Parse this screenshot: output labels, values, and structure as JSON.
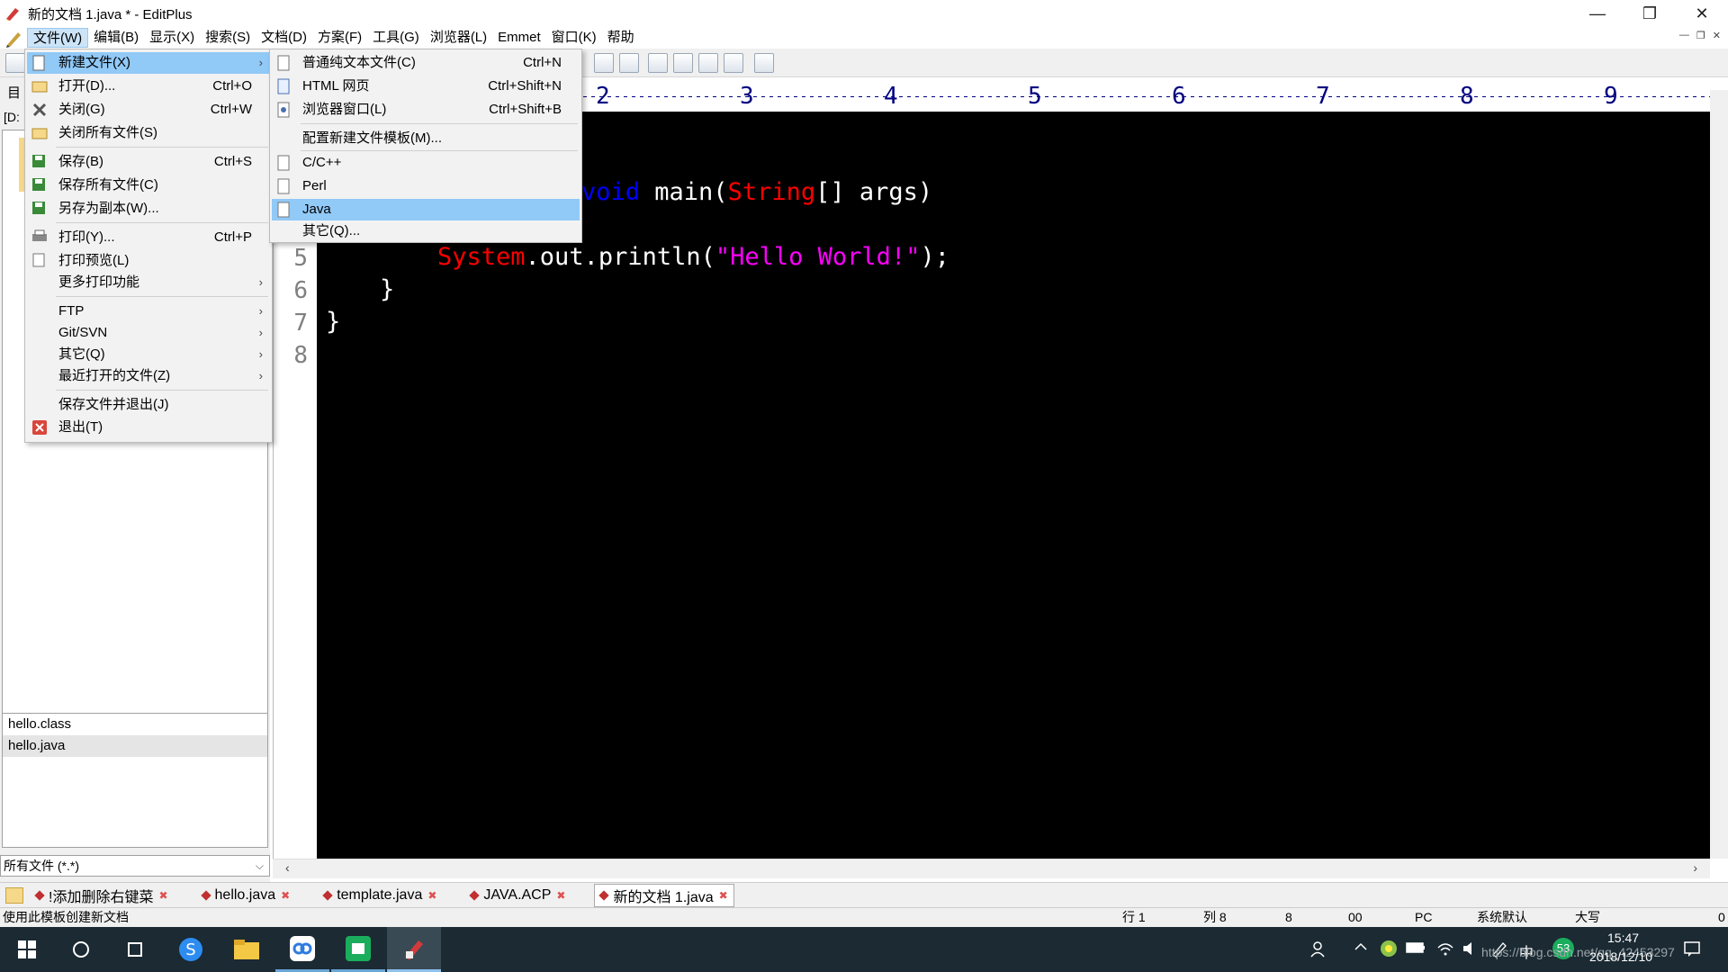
{
  "window": {
    "title": "新的文档 1.java * - EditPlus"
  },
  "menubar": [
    "文件(W)",
    "编辑(B)",
    "显示(X)",
    "搜索(S)",
    "文档(D)",
    "方案(F)",
    "工具(G)",
    "浏览器(L)",
    "Emmet",
    "窗口(K)",
    "帮助"
  ],
  "left_panel": {
    "tab_label": "目",
    "drive_label": "[D:",
    "files": [
      "hello.class",
      "hello.java"
    ],
    "filter": "所有文件 (*.*)"
  },
  "file_menu": {
    "items": [
      {
        "label": "新建文件(X)",
        "shortcut": "",
        "submenu": true
      },
      {
        "label": "打开(D)...",
        "shortcut": "Ctrl+O"
      },
      {
        "label": "关闭(G)",
        "shortcut": "Ctrl+W"
      },
      {
        "label": "关闭所有文件(S)",
        "shortcut": ""
      },
      {
        "label": "保存(B)",
        "shortcut": "Ctrl+S"
      },
      {
        "label": "保存所有文件(C)",
        "shortcut": ""
      },
      {
        "label": "另存为副本(W)...",
        "shortcut": ""
      },
      {
        "label": "打印(Y)...",
        "shortcut": "Ctrl+P"
      },
      {
        "label": "打印预览(L)",
        "shortcut": ""
      },
      {
        "label": "更多打印功能",
        "shortcut": "",
        "submenu": true
      },
      {
        "label": "FTP",
        "shortcut": "",
        "submenu": true
      },
      {
        "label": "Git/SVN",
        "shortcut": "",
        "submenu": true
      },
      {
        "label": "其它(Q)",
        "shortcut": "",
        "submenu": true
      },
      {
        "label": "最近打开的文件(Z)",
        "shortcut": "",
        "submenu": true
      },
      {
        "label": "保存文件并退出(J)",
        "shortcut": ""
      },
      {
        "label": "退出(T)",
        "shortcut": ""
      }
    ]
  },
  "new_submenu": {
    "items": [
      {
        "label": "普通纯文本文件(C)",
        "shortcut": "Ctrl+N"
      },
      {
        "label": "HTML 网页",
        "shortcut": "Ctrl+Shift+N"
      },
      {
        "label": "浏览器窗口(L)",
        "shortcut": "Ctrl+Shift+B"
      },
      {
        "label": "配置新建文件模板(M)...",
        "shortcut": ""
      },
      {
        "label": "C/C++",
        "shortcut": ""
      },
      {
        "label": "Perl",
        "shortcut": ""
      },
      {
        "label": "Java",
        "shortcut": ""
      },
      {
        "label": "其它(Q)...",
        "shortcut": ""
      }
    ],
    "highlighted": "Java"
  },
  "ruler": [
    "2",
    "3",
    "4",
    "5",
    "6",
    "7",
    "8",
    "9"
  ],
  "editor": {
    "line_numbers": [
      "5",
      "6",
      "7",
      "8"
    ],
    "code": {
      "l3_kw": "void",
      "l3_a": " main(",
      "l3_type": "String",
      "l3_b": "[] args)",
      "l5_cls": "System",
      "l5_a": ".out.println(",
      "l5_str": "\"Hello World!\"",
      "l5_b": ");",
      "l6": "}",
      "l7": "}"
    },
    "colors": {
      "keyword": "#0000ff",
      "type": "#ff0000",
      "string": "#ff00ff",
      "text": "#ffffff",
      "background": "#000000"
    }
  },
  "doc_tabs": [
    "!添加删除右键菜",
    "hello.java",
    "template.java",
    "JAVA.ACP",
    "新的文档 1.java"
  ],
  "status": {
    "hint": "使用此模板创建新文档",
    "row": "行 1",
    "col": "列 8",
    "v1": "8",
    "v2": "00",
    "mode": "PC",
    "encoding": "系统默认",
    "caps": "大写",
    "end": "0"
  },
  "taskbar": {
    "badge": "53",
    "time": "15:47",
    "date": "2018/12/10",
    "watermark": "https://blog.csdn.net/qq_42453297",
    "ime": "中"
  }
}
